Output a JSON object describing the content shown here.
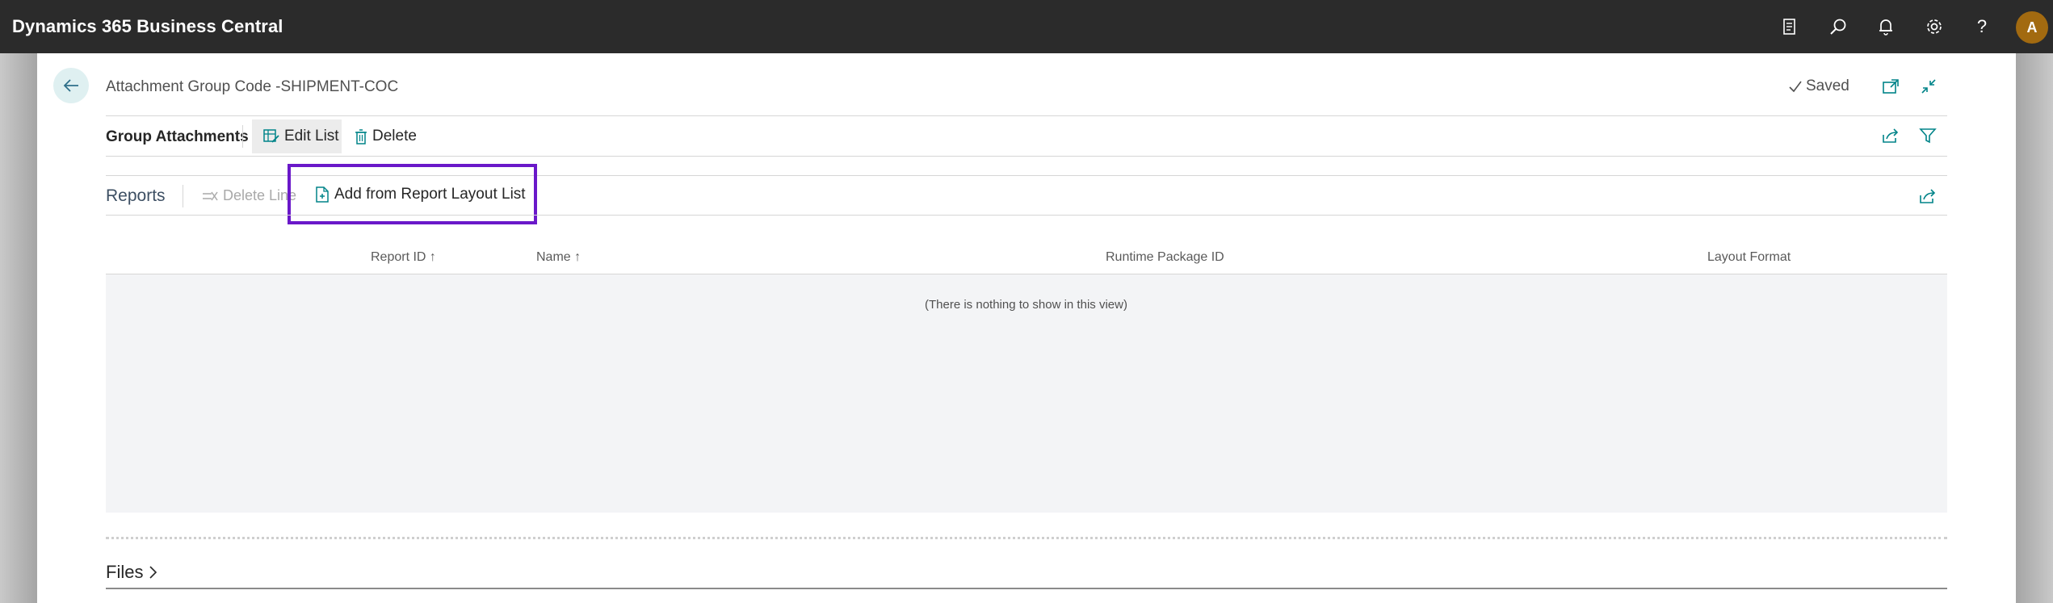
{
  "app": {
    "title": "Dynamics 365 Business Central",
    "avatar_initial": "A",
    "icons": [
      "report-icon",
      "search-icon",
      "bell-icon",
      "gear-icon",
      "help-icon"
    ]
  },
  "page": {
    "record_title": "Attachment Group Code -SHIPMENT-COC",
    "saved_label": "Saved"
  },
  "actionbar": {
    "caption": "Group Attachments",
    "edit_list_label": "Edit List",
    "delete_label": "Delete"
  },
  "reports": {
    "caption": "Reports",
    "delete_line_label": "Delete Line",
    "add_label": "Add from Report Layout List",
    "columns": [
      {
        "label": "Report ID",
        "sort": "↑"
      },
      {
        "label": "Name",
        "sort": "↑"
      },
      {
        "label": "Runtime Package ID",
        "sort": ""
      },
      {
        "label": "Layout Format",
        "sort": ""
      }
    ],
    "empty_message": "(There is nothing to show in this view)"
  },
  "files": {
    "caption": "Files"
  },
  "colors": {
    "appbar": "#2b2b2b",
    "accent_teal": "#008489",
    "highlight_purple": "#6a18c9",
    "avatar": "#a26a10"
  }
}
